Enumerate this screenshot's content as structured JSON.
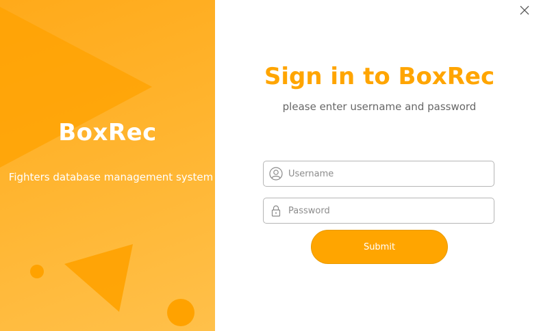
{
  "brand_panel": {
    "app_name": "BoxRec",
    "tagline": "Fighters database management system"
  },
  "login": {
    "title": "Sign in to BoxRec",
    "subtitle": "please enter username and password",
    "username_placeholder": "Username",
    "password_placeholder": "Password",
    "submit_label": "Submit"
  },
  "icons": {
    "close": "close-icon",
    "user": "user-icon",
    "lock": "lock-icon"
  },
  "colors": {
    "accent": "#ffa500",
    "panel": "#ffb42e",
    "panel_shapes": "#ffa200"
  }
}
